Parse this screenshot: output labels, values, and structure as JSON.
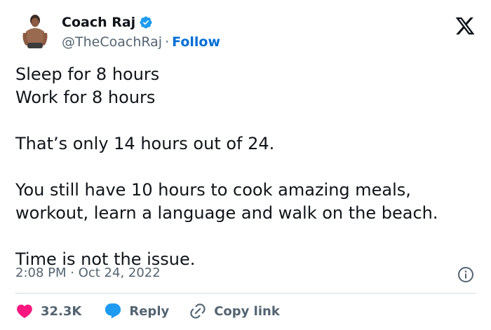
{
  "author": {
    "display_name": "Coach Raj",
    "handle": "@TheCoachRaj",
    "separator": "·",
    "follow_label": "Follow",
    "verified": true
  },
  "tweet": {
    "lines": [
      "Sleep for 8 hours",
      "Work for 8 hours",
      "That’s only 14 hours out of 24.",
      "You still have 10 hours to cook amazing meals, workout, learn a language and walk on the beach.",
      "Time is not the issue."
    ],
    "timestamp": "2:08 PM · Oct 24, 2022"
  },
  "actions": {
    "like_count": "32.3K",
    "reply_label": "Reply",
    "copy_link_label": "Copy link"
  },
  "colors": {
    "accent": "#006fd6",
    "like": "#f91880",
    "verified": "#1d9bf0",
    "muted": "#536471",
    "divider": "#cfd9de"
  },
  "icons": {
    "brand": "x-logo-icon",
    "verified": "verified-badge-icon",
    "info": "info-icon",
    "like": "heart-icon",
    "reply": "speech-bubble-icon",
    "copy_link": "link-icon"
  }
}
